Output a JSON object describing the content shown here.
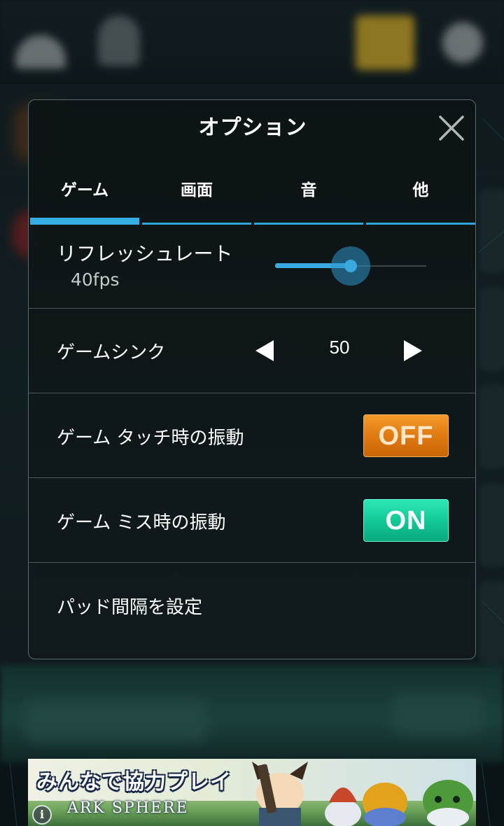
{
  "dialog": {
    "title": "オプション",
    "close_icon": "close-icon"
  },
  "tabs": [
    {
      "label": "ゲーム",
      "active": true
    },
    {
      "label": "画面",
      "active": false
    },
    {
      "label": "音",
      "active": false
    },
    {
      "label": "他",
      "active": false
    }
  ],
  "settings": {
    "refresh_rate": {
      "label": "リフレッシュレート",
      "value_text": "40fps",
      "slider_fraction": 0.5
    },
    "game_sync": {
      "label": "ゲームシンク",
      "value": "50",
      "decrement_icon": "triangle-left-icon",
      "increment_icon": "triangle-right-icon"
    },
    "touch_vibration": {
      "label": "ゲーム タッチ時の振動",
      "state": "OFF"
    },
    "miss_vibration": {
      "label": "ゲーム ミス時の振動",
      "state": "ON"
    },
    "pad_spacing": {
      "label": "パッド間隔を設定"
    }
  },
  "ad": {
    "headline": "みんなで協力プレイ",
    "logo_text": "ARK SPHERE",
    "info_icon": "info-icon"
  },
  "colors": {
    "accent_blue": "#36aee4",
    "toggle_off": "#e07a12",
    "toggle_on": "#13c996"
  }
}
